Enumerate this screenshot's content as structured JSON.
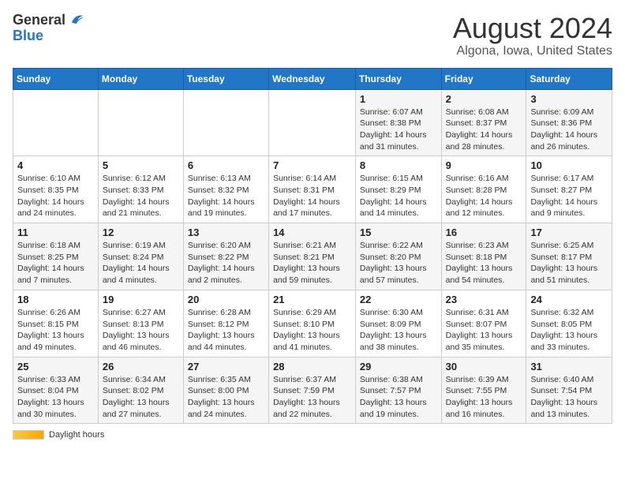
{
  "header": {
    "logo_general": "General",
    "logo_blue": "Blue",
    "main_title": "August 2024",
    "subtitle": "Algona, Iowa, United States"
  },
  "calendar": {
    "days_of_week": [
      "Sunday",
      "Monday",
      "Tuesday",
      "Wednesday",
      "Thursday",
      "Friday",
      "Saturday"
    ],
    "weeks": [
      [
        {
          "day": "",
          "info": ""
        },
        {
          "day": "",
          "info": ""
        },
        {
          "day": "",
          "info": ""
        },
        {
          "day": "",
          "info": ""
        },
        {
          "day": "1",
          "info": "Sunrise: 6:07 AM\nSunset: 8:38 PM\nDaylight: 14 hours and 31 minutes."
        },
        {
          "day": "2",
          "info": "Sunrise: 6:08 AM\nSunset: 8:37 PM\nDaylight: 14 hours and 28 minutes."
        },
        {
          "day": "3",
          "info": "Sunrise: 6:09 AM\nSunset: 8:36 PM\nDaylight: 14 hours and 26 minutes."
        }
      ],
      [
        {
          "day": "4",
          "info": "Sunrise: 6:10 AM\nSunset: 8:35 PM\nDaylight: 14 hours and 24 minutes."
        },
        {
          "day": "5",
          "info": "Sunrise: 6:12 AM\nSunset: 8:33 PM\nDaylight: 14 hours and 21 minutes."
        },
        {
          "day": "6",
          "info": "Sunrise: 6:13 AM\nSunset: 8:32 PM\nDaylight: 14 hours and 19 minutes."
        },
        {
          "day": "7",
          "info": "Sunrise: 6:14 AM\nSunset: 8:31 PM\nDaylight: 14 hours and 17 minutes."
        },
        {
          "day": "8",
          "info": "Sunrise: 6:15 AM\nSunset: 8:29 PM\nDaylight: 14 hours and 14 minutes."
        },
        {
          "day": "9",
          "info": "Sunrise: 6:16 AM\nSunset: 8:28 PM\nDaylight: 14 hours and 12 minutes."
        },
        {
          "day": "10",
          "info": "Sunrise: 6:17 AM\nSunset: 8:27 PM\nDaylight: 14 hours and 9 minutes."
        }
      ],
      [
        {
          "day": "11",
          "info": "Sunrise: 6:18 AM\nSunset: 8:25 PM\nDaylight: 14 hours and 7 minutes."
        },
        {
          "day": "12",
          "info": "Sunrise: 6:19 AM\nSunset: 8:24 PM\nDaylight: 14 hours and 4 minutes."
        },
        {
          "day": "13",
          "info": "Sunrise: 6:20 AM\nSunset: 8:22 PM\nDaylight: 14 hours and 2 minutes."
        },
        {
          "day": "14",
          "info": "Sunrise: 6:21 AM\nSunset: 8:21 PM\nDaylight: 13 hours and 59 minutes."
        },
        {
          "day": "15",
          "info": "Sunrise: 6:22 AM\nSunset: 8:20 PM\nDaylight: 13 hours and 57 minutes."
        },
        {
          "day": "16",
          "info": "Sunrise: 6:23 AM\nSunset: 8:18 PM\nDaylight: 13 hours and 54 minutes."
        },
        {
          "day": "17",
          "info": "Sunrise: 6:25 AM\nSunset: 8:17 PM\nDaylight: 13 hours and 51 minutes."
        }
      ],
      [
        {
          "day": "18",
          "info": "Sunrise: 6:26 AM\nSunset: 8:15 PM\nDaylight: 13 hours and 49 minutes."
        },
        {
          "day": "19",
          "info": "Sunrise: 6:27 AM\nSunset: 8:13 PM\nDaylight: 13 hours and 46 minutes."
        },
        {
          "day": "20",
          "info": "Sunrise: 6:28 AM\nSunset: 8:12 PM\nDaylight: 13 hours and 44 minutes."
        },
        {
          "day": "21",
          "info": "Sunrise: 6:29 AM\nSunset: 8:10 PM\nDaylight: 13 hours and 41 minutes."
        },
        {
          "day": "22",
          "info": "Sunrise: 6:30 AM\nSunset: 8:09 PM\nDaylight: 13 hours and 38 minutes."
        },
        {
          "day": "23",
          "info": "Sunrise: 6:31 AM\nSunset: 8:07 PM\nDaylight: 13 hours and 35 minutes."
        },
        {
          "day": "24",
          "info": "Sunrise: 6:32 AM\nSunset: 8:05 PM\nDaylight: 13 hours and 33 minutes."
        }
      ],
      [
        {
          "day": "25",
          "info": "Sunrise: 6:33 AM\nSunset: 8:04 PM\nDaylight: 13 hours and 30 minutes."
        },
        {
          "day": "26",
          "info": "Sunrise: 6:34 AM\nSunset: 8:02 PM\nDaylight: 13 hours and 27 minutes."
        },
        {
          "day": "27",
          "info": "Sunrise: 6:35 AM\nSunset: 8:00 PM\nDaylight: 13 hours and 24 minutes."
        },
        {
          "day": "28",
          "info": "Sunrise: 6:37 AM\nSunset: 7:59 PM\nDaylight: 13 hours and 22 minutes."
        },
        {
          "day": "29",
          "info": "Sunrise: 6:38 AM\nSunset: 7:57 PM\nDaylight: 13 hours and 19 minutes."
        },
        {
          "day": "30",
          "info": "Sunrise: 6:39 AM\nSunset: 7:55 PM\nDaylight: 13 hours and 16 minutes."
        },
        {
          "day": "31",
          "info": "Sunrise: 6:40 AM\nSunset: 7:54 PM\nDaylight: 13 hours and 13 minutes."
        }
      ]
    ]
  },
  "footer": {
    "daylight_label": "Daylight hours"
  }
}
